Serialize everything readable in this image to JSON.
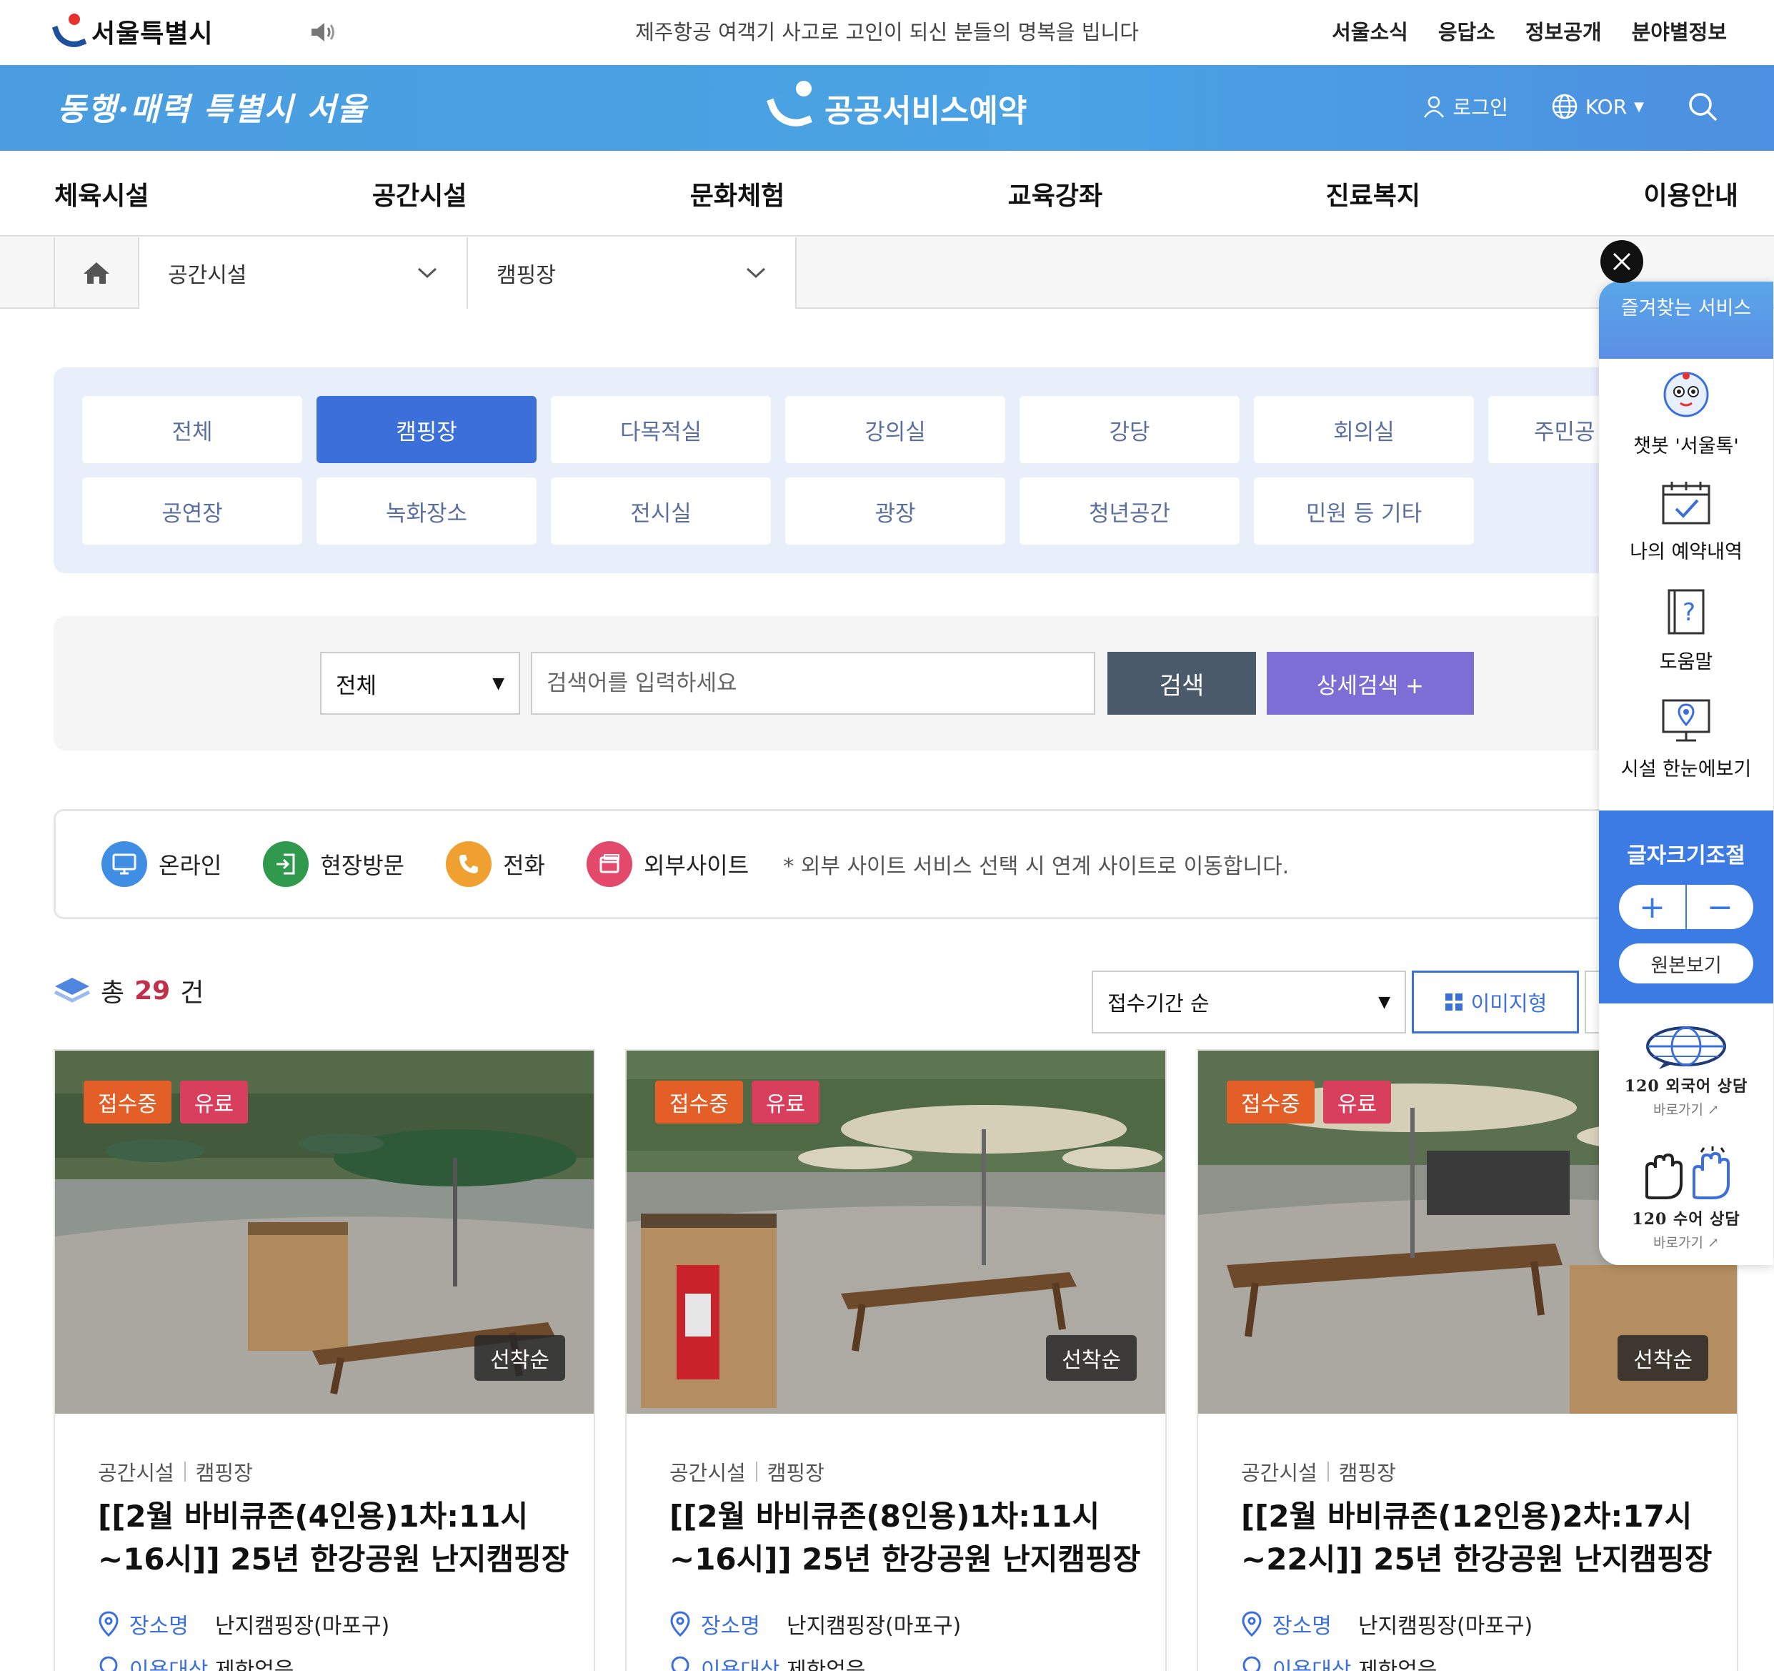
{
  "topbar": {
    "logo_text": "서울특별시",
    "notice": "제주항공 여객기 사고로 고인이 되신 분들의 명복을 빕니다",
    "links": [
      "서울소식",
      "응답소",
      "정보공개",
      "분야별정보"
    ]
  },
  "banner": {
    "slogan": "동행·매력 특별시 서울",
    "service_title": "공공서비스예약",
    "login_label": "로그인",
    "language_label": "KOR"
  },
  "nav": {
    "items": [
      "체육시설",
      "공간시설",
      "문화체험",
      "교육강좌",
      "진료복지",
      "이용안내"
    ]
  },
  "breadcrumb": {
    "level1": "공간시설",
    "level2": "캠핑장"
  },
  "categories": {
    "row1": [
      "전체",
      "캠핑장",
      "다목적실",
      "강의실",
      "강당",
      "회의실",
      "주민공"
    ],
    "row2": [
      "공연장",
      "녹화장소",
      "전시실",
      "광장",
      "청년공간",
      "민원 등 기타"
    ],
    "active": "캠핑장"
  },
  "search": {
    "select_value": "전체",
    "placeholder": "검색어를 입력하세요",
    "search_label": "검색",
    "detail_label": "상세검색 +"
  },
  "legend": {
    "online": "온라인",
    "visit": "현장방문",
    "phone": "전화",
    "external": "외부사이트",
    "note": "* 외부 사이트 서비스 선택 시 연계 사이트로 이동합니다."
  },
  "results": {
    "prefix": "총",
    "count": "29",
    "suffix": "건",
    "sort_value": "접수기간 순",
    "view_label": "이미지형"
  },
  "cards": [
    {
      "status": "접수중",
      "fee": "유료",
      "method": "선착순",
      "category": "공간시설",
      "subcategory": "캠핑장",
      "title": "[[2월 바비큐존(4인용)1차:11시~16시]] 25년 한강공원 난지캠핑장",
      "place_label": "장소명",
      "place": "난지캠핑장(마포구)",
      "target_label": "이용대상",
      "target": "제한없음"
    },
    {
      "status": "접수중",
      "fee": "유료",
      "method": "선착순",
      "category": "공간시설",
      "subcategory": "캠핑장",
      "title": "[[2월 바비큐존(8인용)1차:11시~16시]] 25년 한강공원 난지캠핑장",
      "place_label": "장소명",
      "place": "난지캠핑장(마포구)",
      "target_label": "이용대상",
      "target": "제한없음"
    },
    {
      "status": "접수중",
      "fee": "유료",
      "method": "선착순",
      "category": "공간시설",
      "subcategory": "캠핑장",
      "title": "[[2월 바비큐존(12인용)2차:17시~22시]] 25년 한강공원 난지캠핑장",
      "place_label": "장소명",
      "place": "난지캠핑장(마포구)",
      "target_label": "이용대상",
      "target": "제한없음"
    }
  ],
  "quick_panel": {
    "title": "즐겨찾는 서비스",
    "items": [
      "챗봇 '서울톡'",
      "나의 예약내역",
      "도움말",
      "시설 한눈에보기"
    ],
    "font_title": "글자크기조절",
    "plus": "+",
    "minus": "−",
    "original": "원본보기",
    "foreign_line1": "120 외국어 상담",
    "foreign_line2": "바로가기",
    "sign_line1": "120 수어 상담",
    "sign_line2": "바로가기"
  },
  "colors": {
    "accent": "#3b6fd9",
    "banner": "#4aa3e4",
    "badge_open": "#e35f27",
    "badge_paid": "#d83f5c",
    "search_button": "#4a5a6b",
    "detail_button": "#7b6fd6",
    "count": "#c0304a"
  }
}
